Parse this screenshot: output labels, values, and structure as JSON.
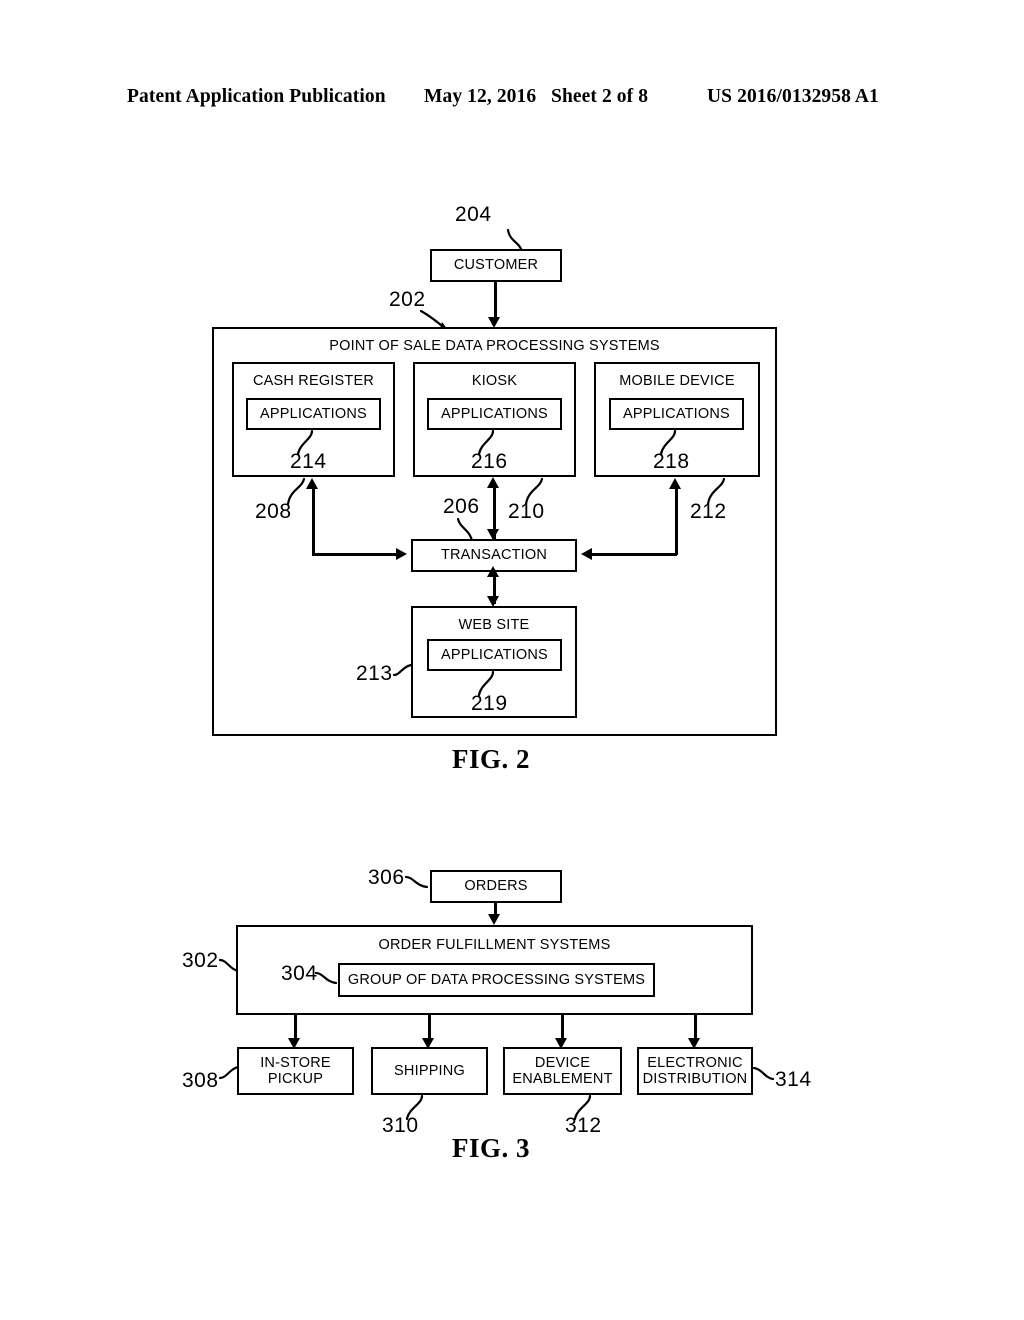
{
  "header": {
    "publication": "Patent Application Publication",
    "date": "May 12, 2016",
    "sheet": "Sheet 2 of 8",
    "number": "US 2016/0132958 A1"
  },
  "figures": [
    {
      "caption": "FIG. 2",
      "nodes": {
        "customer": "CUSTOMER",
        "pos_systems": "POINT OF SALE DATA PROCESSING SYSTEMS",
        "cash_register": "CASH REGISTER",
        "kiosk": "KIOSK",
        "mobile_device": "MOBILE DEVICE",
        "applications": "APPLICATIONS",
        "transaction": "TRANSACTION",
        "web_site": "WEB SITE"
      },
      "refs": {
        "pos_systems": "202",
        "customer": "204",
        "transaction": "206",
        "cash_register_link": "208",
        "kiosk_link": "210",
        "mobile_link": "212",
        "web_site": "213",
        "cash_register_apps": "214",
        "kiosk_apps": "216",
        "mobile_apps": "218",
        "web_site_apps": "219"
      }
    },
    {
      "caption": "FIG. 3",
      "nodes": {
        "orders": "ORDERS",
        "order_fulfillment": "ORDER FULFILLMENT SYSTEMS",
        "group_of_dps": "GROUP OF DATA PROCESSING SYSTEMS",
        "in_store_pickup": "IN-STORE PICKUP",
        "shipping": "SHIPPING",
        "device_enablement": "DEVICE ENABLEMENT",
        "electronic_distribution": "ELECTRONIC DISTRIBUTION"
      },
      "refs": {
        "order_fulfillment": "302",
        "group_of_dps": "304",
        "orders": "306",
        "in_store_pickup": "308",
        "shipping": "310",
        "device_enablement": "312",
        "electronic_distribution": "314"
      }
    }
  ],
  "colors": {
    "ink": "#000000",
    "paper": "#ffffff"
  }
}
